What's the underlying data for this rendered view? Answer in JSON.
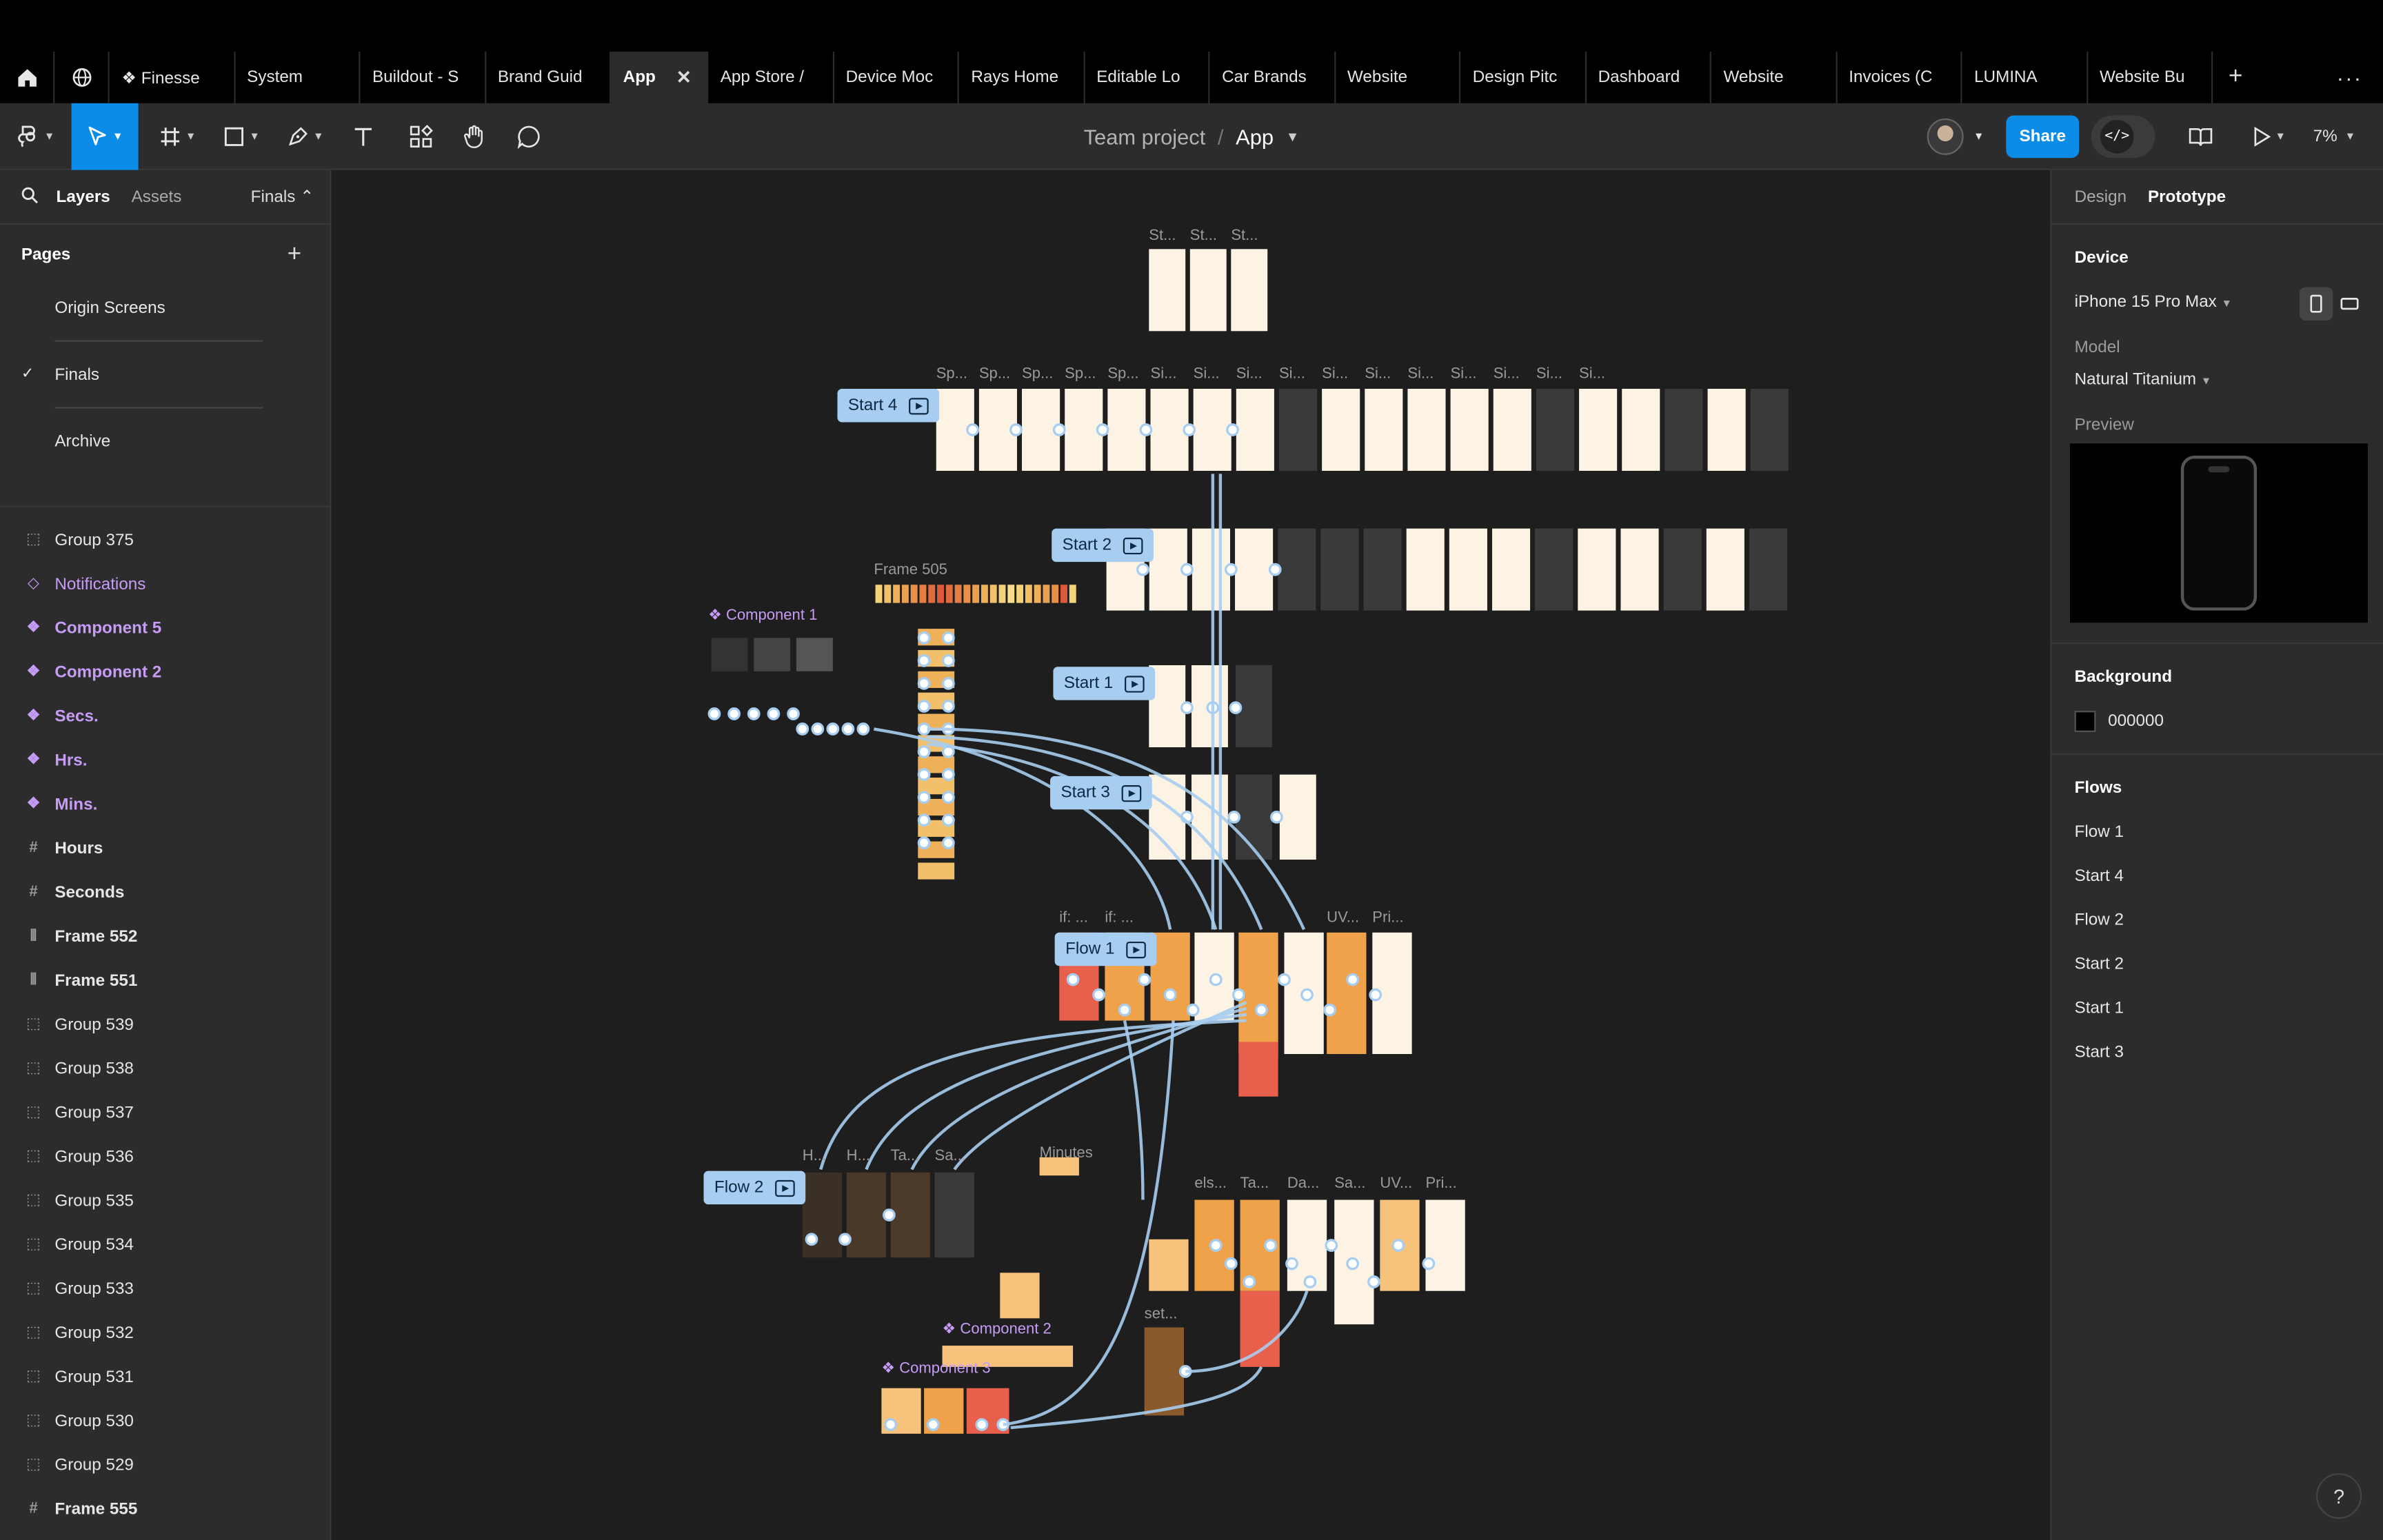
{
  "tabs": {
    "items": [
      "❖ Finesse",
      "System",
      "Buildout - S",
      "Brand Guid",
      "App",
      "App Store /",
      "Device Moc",
      "Rays Home",
      "Editable Lo",
      "Car Brands",
      "Website",
      "Design Pitc",
      "Dashboard",
      "Website",
      "Invoices (C",
      "LUMINA",
      "Website Bu"
    ],
    "active_index": 4,
    "close_glyph": "✕",
    "plus_glyph": "+",
    "more_glyph": "···"
  },
  "toolbar": {
    "project": "Team project",
    "separator": "/",
    "file": "App",
    "share_label": "Share",
    "dev_mode_glyph": "</>",
    "zoom": "7%"
  },
  "left_panel": {
    "tab_layers": "Layers",
    "tab_assets": "Assets",
    "page_switcher": "Finals ⌃",
    "pages_title": "Pages",
    "pages": [
      "Origin Screens",
      "Finals",
      "Archive"
    ],
    "current_page": "Finals",
    "layers": [
      {
        "label": "Group 375",
        "icon": "group-icon",
        "kind": "group"
      },
      {
        "label": "Notifications",
        "icon": "component-instance-icon",
        "kind": "comp-light"
      },
      {
        "label": "Component 5",
        "icon": "component-icon",
        "kind": "comp"
      },
      {
        "label": "Component 2",
        "icon": "component-icon",
        "kind": "comp"
      },
      {
        "label": "Secs.",
        "icon": "component-icon",
        "kind": "comp"
      },
      {
        "label": "Hrs.",
        "icon": "component-icon",
        "kind": "comp"
      },
      {
        "label": "Mins.",
        "icon": "component-icon",
        "kind": "comp"
      },
      {
        "label": "Hours",
        "icon": "frame-icon",
        "kind": "frame"
      },
      {
        "label": "Seconds",
        "icon": "frame-icon",
        "kind": "frame"
      },
      {
        "label": "Frame 552",
        "icon": "autolayout-icon",
        "kind": "frame"
      },
      {
        "label": "Frame 551",
        "icon": "autolayout-icon",
        "kind": "frame"
      },
      {
        "label": "Group 539",
        "icon": "group-icon",
        "kind": "group"
      },
      {
        "label": "Group 538",
        "icon": "group-icon",
        "kind": "group"
      },
      {
        "label": "Group 537",
        "icon": "group-icon",
        "kind": "group"
      },
      {
        "label": "Group 536",
        "icon": "group-icon",
        "kind": "group"
      },
      {
        "label": "Group 535",
        "icon": "group-icon",
        "kind": "group"
      },
      {
        "label": "Group 534",
        "icon": "group-icon",
        "kind": "group"
      },
      {
        "label": "Group 533",
        "icon": "group-icon",
        "kind": "group"
      },
      {
        "label": "Group 532",
        "icon": "group-icon",
        "kind": "group"
      },
      {
        "label": "Group 531",
        "icon": "group-icon",
        "kind": "group"
      },
      {
        "label": "Group 530",
        "icon": "group-icon",
        "kind": "group"
      },
      {
        "label": "Group 529",
        "icon": "group-icon",
        "kind": "group"
      },
      {
        "label": "Frame 555",
        "icon": "frame-icon",
        "kind": "frame"
      }
    ]
  },
  "right_panel": {
    "tab_design": "Design",
    "tab_prototype": "Prototype",
    "device_title": "Device",
    "device_value": "iPhone 15 Pro Max",
    "model_label": "Model",
    "model_value": "Natural Titanium",
    "preview_label": "Preview",
    "background_title": "Background",
    "background_value": "000000",
    "flows_title": "Flows",
    "flows": [
      "Flow 1",
      "Start 4",
      "Flow 2",
      "Start 2",
      "Start 1",
      "Start 3"
    ]
  },
  "canvas": {
    "flow_tags": [
      "Start 4",
      "Start 2",
      "Start 1",
      "Start 3",
      "Flow 1",
      "Flow 2"
    ],
    "frame_labels": [
      "Frame 505",
      "Minutes",
      "set...",
      "if: ...",
      "if: ...",
      "UV...",
      "Pri...",
      "els...",
      "Ta...",
      "Da...",
      "Sa...",
      "UV...",
      "Pri..."
    ],
    "component_labels": [
      "❖ Component 1",
      "❖ Component 2",
      "❖ Component 3"
    ],
    "top_row_labels": [
      "St...",
      "St...",
      "St..."
    ],
    "start4_labels": [
      "Sp...",
      "Sp...",
      "Sp...",
      "Sp...",
      "Sp...",
      "Si...",
      "Si...",
      "Si...",
      "Si...",
      "Si...",
      "Si...",
      "Si...",
      "Si...",
      "Si...",
      "Si...",
      "Si..."
    ],
    "flow2_labels": [
      "H...",
      "H...",
      "Ta...",
      "Sa..."
    ],
    "help_glyph": "?"
  },
  "colors": {
    "accent": "#0c8ce9",
    "flow_tag": "#a7cdf0",
    "component": "#c69cf7",
    "connector": "#a7cdf0"
  }
}
